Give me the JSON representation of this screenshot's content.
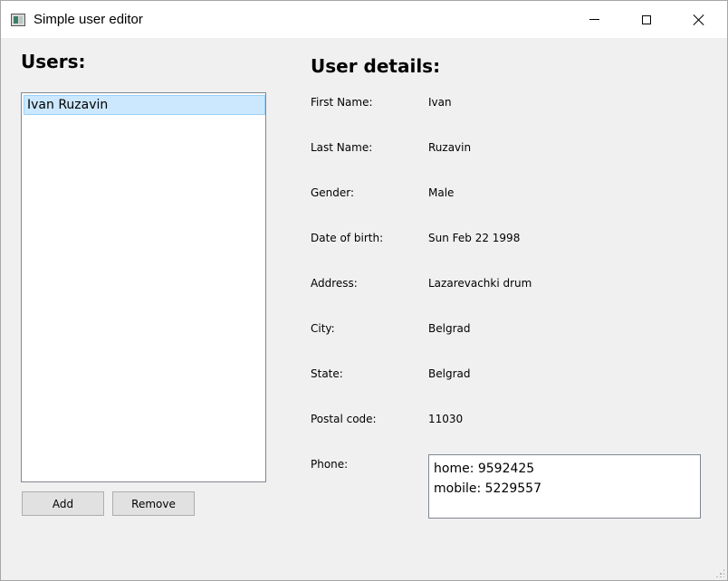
{
  "window": {
    "title": "Simple user editor",
    "icon": "app-icon"
  },
  "users": {
    "heading": "Users:",
    "items": [
      "Ivan Ruzavin"
    ],
    "selected_index": 0,
    "add_label": "Add",
    "remove_label": "Remove"
  },
  "details": {
    "heading": "User details:",
    "first_name_label": "First Name:",
    "first_name": "Ivan",
    "last_name_label": "Last Name:",
    "last_name": "Ruzavin",
    "gender_label": "Gender:",
    "gender": "Male",
    "dob_label": "Date of birth:",
    "dob": "Sun Feb 22 1998",
    "address_label": "Address:",
    "address": "Lazarevachki drum",
    "city_label": "City:",
    "city": "Belgrad",
    "state_label": "State:",
    "state": "Belgrad",
    "postal_label": "Postal code:",
    "postal": "11030",
    "phone_label": "Phone:",
    "phones": [
      "home: 9592425",
      "mobile: 5229557"
    ]
  },
  "colors": {
    "selection_bg": "#cce8ff",
    "selection_border": "#99d1ff",
    "window_bg": "#f0f0f0"
  }
}
